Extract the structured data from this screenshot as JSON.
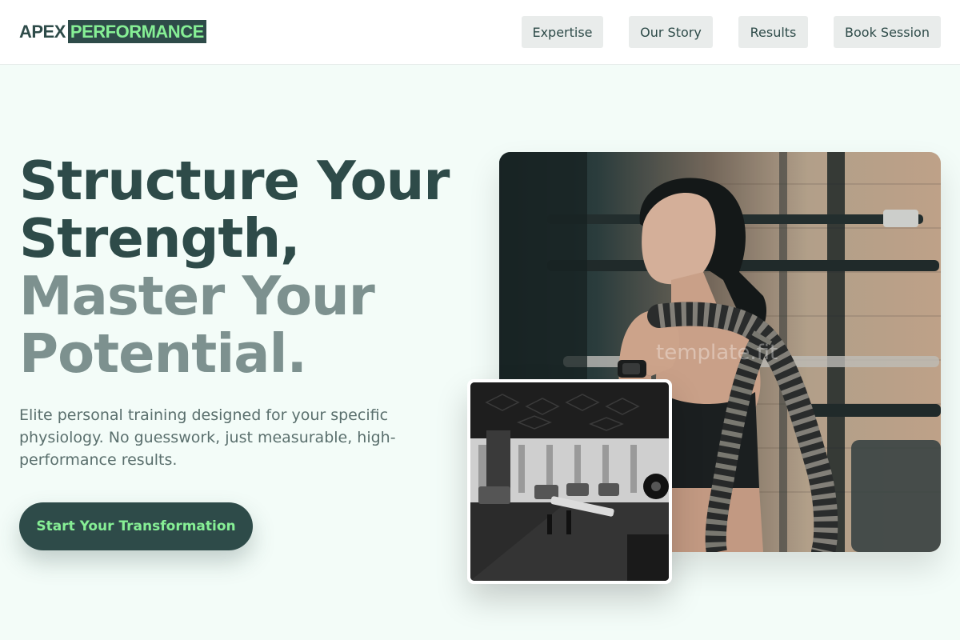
{
  "header": {
    "logo": {
      "part1": "APEX",
      "part2": "PERFORMANCE"
    },
    "nav": [
      {
        "label": "Expertise"
      },
      {
        "label": "Our Story"
      },
      {
        "label": "Results"
      },
      {
        "label": "Book Session"
      }
    ]
  },
  "hero": {
    "headline_line1": "Structure Your",
    "headline_line2": "Strength,",
    "headline_line3": "Master Your",
    "headline_line4": "Potential.",
    "subtext": "Elite personal training designed for your specific physiology. No guesswork, just measurable, high-performance results.",
    "cta_label": "Start Your Transformation"
  },
  "media": {
    "main_photo_watermark": "template.fit"
  },
  "colors": {
    "primary": "#2e4b49",
    "accent": "#86ef95",
    "background": "#f3fcf8",
    "muted_heading": "#7d918f"
  }
}
